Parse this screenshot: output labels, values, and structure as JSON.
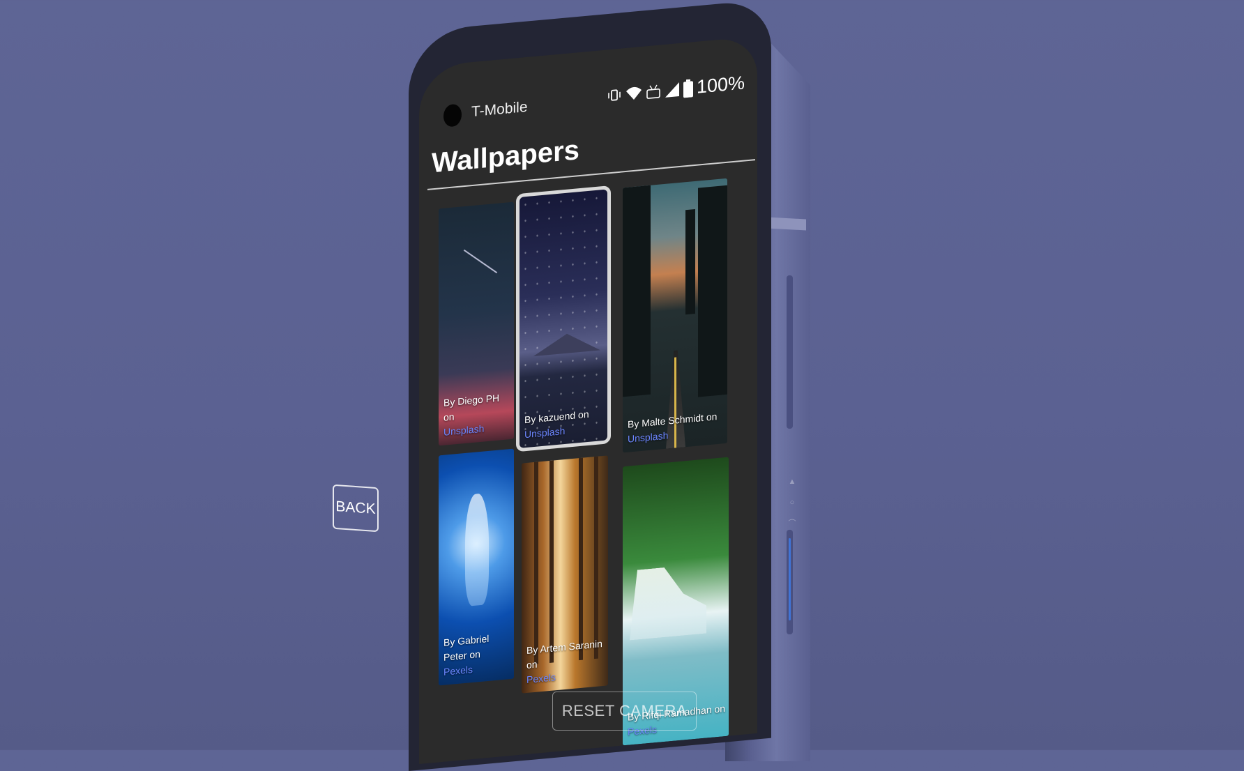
{
  "status_bar": {
    "carrier": "T-Mobile",
    "battery": "100%"
  },
  "header": {
    "title": "Wallpapers"
  },
  "wallpapers": [
    {
      "credit": "By Diego PH on",
      "source": "Unsplash"
    },
    {
      "credit": "By kazuend on",
      "source": "Unsplash",
      "selected": true
    },
    {
      "credit": "By Malte Schmidt on",
      "source": "Unsplash"
    },
    {
      "credit": "By Gabriel Peter on",
      "source": "Pexels"
    },
    {
      "credit": "By Artem Saranin on",
      "source": "Pexels"
    },
    {
      "credit": "By Rifqi Ramadhan on",
      "source": "Pexels"
    }
  ],
  "controls": {
    "back_label": "BACK",
    "reset_label": "RESET CAMERA"
  },
  "colors": {
    "background": "#5e6595",
    "screen": "#2b2b2b",
    "link": "#6c86ff",
    "accent": "#3f74d6"
  },
  "icons": [
    "vibrate-icon",
    "wifi-icon",
    "volte-icon",
    "signal-icon",
    "battery-icon"
  ]
}
